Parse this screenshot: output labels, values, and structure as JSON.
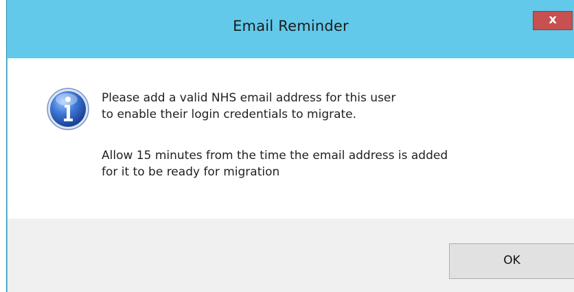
{
  "window": {
    "title": "Email Reminder",
    "close_label": "x",
    "accent_color": "#62c9ea",
    "close_color": "#c75050"
  },
  "message": {
    "icon": "information-icon",
    "paragraph1_line1": "Please add a valid NHS email address for this user",
    "paragraph1_line2": "to enable their login credentials to migrate.",
    "paragraph2_line1": "Allow 15 minutes from the time the email address is added",
    "paragraph2_line2": "for it to be ready for migration"
  },
  "footer": {
    "ok_label": "OK"
  }
}
